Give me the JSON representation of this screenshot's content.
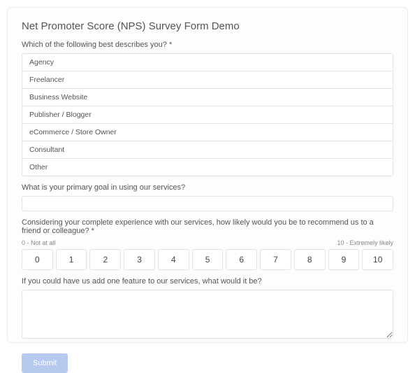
{
  "form": {
    "title": "Net Promoter Score (NPS) Survey Form Demo",
    "q1": {
      "label": "Which of the following best describes you? *",
      "options": [
        "Agency",
        "Freelancer",
        "Business Website",
        "Publisher / Blogger",
        "eCommerce / Store Owner",
        "Consultant",
        "Other"
      ]
    },
    "q2": {
      "label": "What is your primary goal in using our services?",
      "value": ""
    },
    "q3": {
      "label": "Considering your complete experience with our services, how likely would you be to recommend us to a friend or colleague? *",
      "min_label": "0 - Not at all",
      "max_label": "10 - Extremely likely",
      "scale": [
        "0",
        "1",
        "2",
        "3",
        "4",
        "5",
        "6",
        "7",
        "8",
        "9",
        "10"
      ]
    },
    "q4": {
      "label": "If you could have us add one feature to our services, what would it be?",
      "value": ""
    },
    "submit_label": "Submit"
  }
}
